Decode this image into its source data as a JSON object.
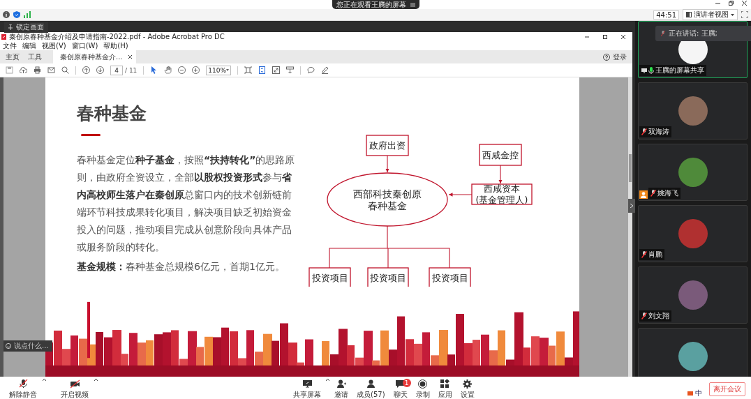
{
  "banner": {
    "text": "您正在观看王腾的屏幕"
  },
  "top_bar": {
    "timer": "44:51",
    "view_button": "演讲者视图"
  },
  "lock_tooltip": "锁定画面",
  "acrobat": {
    "title": "秦创原春种基金介绍及申请指南-2022.pdf - Adobe Acrobat Pro DC",
    "menus": [
      "文件",
      "编辑",
      "视图(V)",
      "窗口(W)",
      "帮助(H)"
    ],
    "tabs": [
      {
        "label": "主页",
        "kind": "nav",
        "selected": false
      },
      {
        "label": "工具",
        "kind": "nav",
        "selected": false
      },
      {
        "label": "秦创原春种基金介...",
        "kind": "document",
        "selected": true
      }
    ],
    "sign_in": "登录",
    "page_current": "4",
    "page_total": "/ 11",
    "zoom": "110%"
  },
  "slide": {
    "title": "春种基金",
    "paragraph": "春种基金定位**种子基金**，按照**“扶持转化”**的思路原则，由政府全资设立，全部**以股权投资形式**参与**省内高校师生落户在秦创原**总窗口内的技术创新链前端环节科技成果转化项目，解决项目缺乏初始资金投入的问题，推动项目完成从创意阶段向具体产品或服务阶段的转化。",
    "scale_line": "**基金规模：**春种基金总规模6亿元，首期1亿元。"
  },
  "diagram": {
    "nodes": [
      {
        "kind": "box",
        "lines": [
          "政府出资"
        ]
      },
      {
        "kind": "box",
        "lines": [
          "西咸金控"
        ]
      },
      {
        "kind": "ellipse",
        "lines": [
          "西部科技秦创原",
          "春种基金"
        ]
      },
      {
        "kind": "box",
        "lines": [
          "西咸资本",
          "(基金管理人)"
        ]
      },
      {
        "kind": "box",
        "lines": [
          "投资项目"
        ]
      },
      {
        "kind": "box",
        "lines": [
          "投资项目"
        ]
      },
      {
        "kind": "box",
        "lines": [
          "投资项目"
        ]
      }
    ]
  },
  "chat_input": {
    "placeholder": "说点什么..."
  },
  "speaking": {
    "text": "正在讲话: 王腾;"
  },
  "participants": [
    {
      "name": "王腾的屏幕共享",
      "sharing": true,
      "muted": false,
      "speaking": true,
      "host": false
    },
    {
      "name": "双海涛",
      "sharing": false,
      "muted": true,
      "speaking": false,
      "host": false
    },
    {
      "name": "姚海飞",
      "sharing": false,
      "muted": true,
      "speaking": false,
      "host": true
    },
    {
      "name": "肖鹏",
      "sharing": false,
      "muted": true,
      "speaking": false,
      "host": false
    },
    {
      "name": "刘文翔",
      "sharing": false,
      "muted": true,
      "speaking": false,
      "host": false
    },
    {
      "speaking": false
    }
  ],
  "toolbar": {
    "left": [
      {
        "label": "解除静音",
        "kind": "mic"
      },
      {
        "label": "开启视频",
        "kind": "video"
      }
    ],
    "center": [
      {
        "label": "共享屏幕",
        "kind": "share"
      },
      {
        "label": "邀请",
        "kind": "invite"
      },
      {
        "label": "成员(57)",
        "kind": "members"
      },
      {
        "label": "聊天",
        "kind": "chat",
        "badge": "1"
      },
      {
        "label": "录制",
        "kind": "record"
      },
      {
        "label": "应用",
        "kind": "apps"
      },
      {
        "label": "设置",
        "kind": "settings"
      }
    ],
    "leave": "离开会议"
  },
  "tray": {
    "ime": "中"
  }
}
